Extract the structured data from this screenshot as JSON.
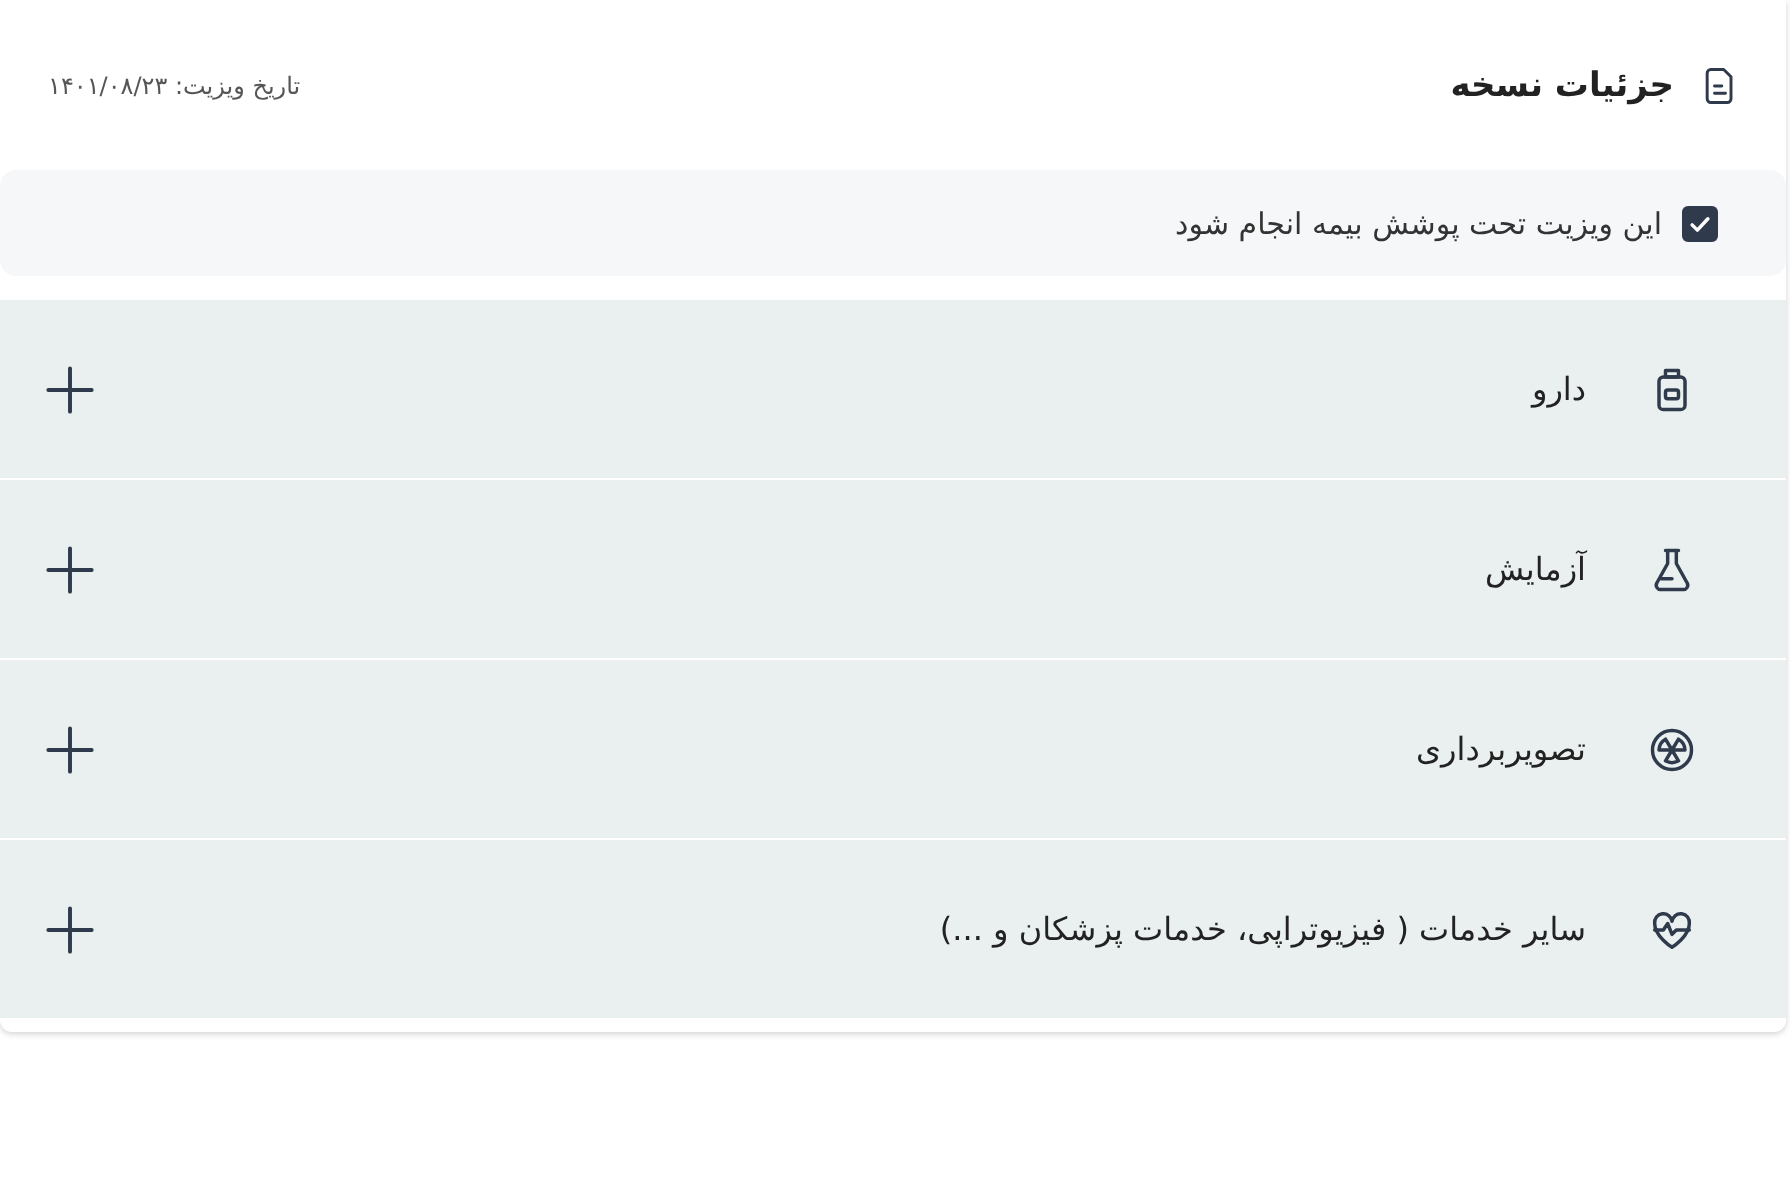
{
  "header": {
    "title": "جزئیات نسخه",
    "visit_date": "تاریخ ویزیت: ۱۴۰۱/۰۸/۲۳"
  },
  "insurance": {
    "label": "این ویزیت تحت پوشش بیمه انجام شود",
    "checked": true
  },
  "sections": [
    {
      "kind": "medicine",
      "label": "دارو"
    },
    {
      "kind": "lab",
      "label": "آزمایش"
    },
    {
      "kind": "imaging",
      "label": "تصویربرداری"
    },
    {
      "kind": "services",
      "label": "سایر خدمات ( فیزیوتراپی، خدمات پزشکان و ...)"
    }
  ]
}
